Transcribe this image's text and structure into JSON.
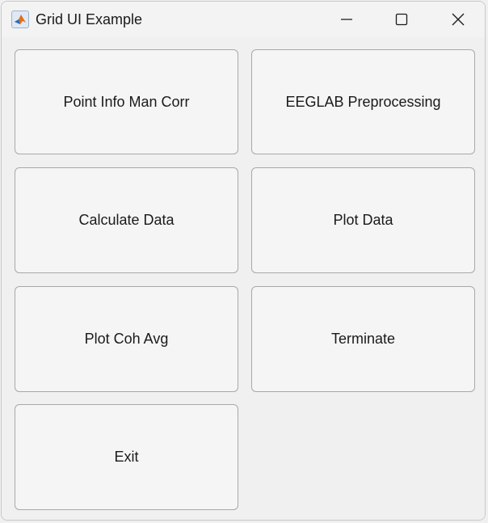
{
  "window": {
    "title": "Grid UI Example",
    "app_icon": "matlab-logo-icon"
  },
  "controls": {
    "minimize_icon": "minimize-icon",
    "maximize_icon": "maximize-icon",
    "close_icon": "close-icon"
  },
  "grid": {
    "buttons": [
      {
        "label": "Point Info Man Corr"
      },
      {
        "label": "EEGLAB Preprocessing"
      },
      {
        "label": "Calculate Data"
      },
      {
        "label": "Plot Data"
      },
      {
        "label": "Plot Coh Avg"
      },
      {
        "label": "Terminate"
      },
      {
        "label": "Exit"
      }
    ]
  }
}
